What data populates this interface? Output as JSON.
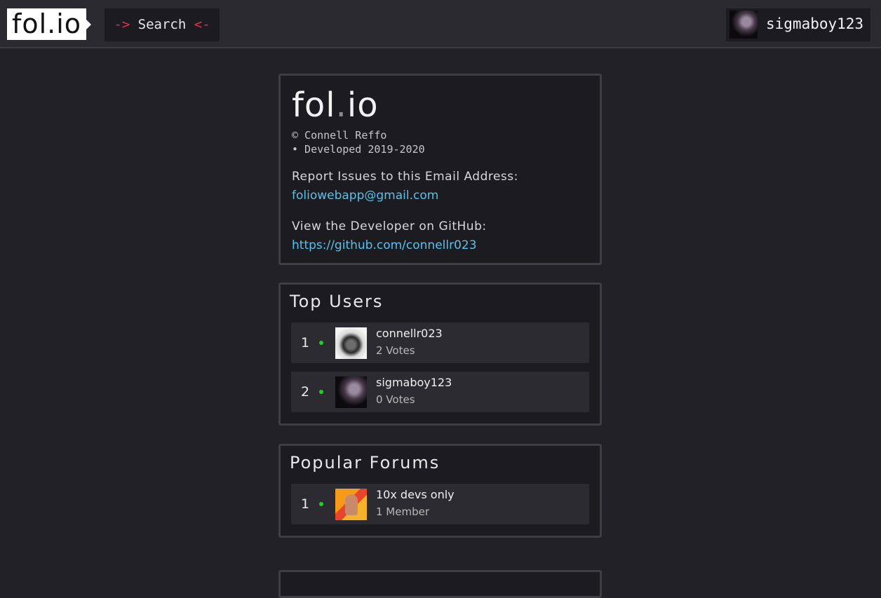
{
  "header": {
    "logo_text": "fol.io",
    "search_prefix": "->",
    "search_label": "Search",
    "search_suffix": "<-",
    "username": "sigmaboy123",
    "avatar_icon": "user-avatar-icon"
  },
  "info": {
    "logo_main": "fol",
    "logo_dot": ".",
    "logo_end": "io",
    "copyright": "© Connell Reffo",
    "developed": "• Developed 2019-2020",
    "issues_label": "Report Issues to this Email Address:",
    "issues_email": "foliowebapp@gmail.com",
    "github_label": "View the Developer on GitHub:",
    "github_url": "https://github.com/connellr023"
  },
  "top_users": {
    "title": "Top Users",
    "items": [
      {
        "rank": "1",
        "name": "connellr023",
        "sub": "2 Votes",
        "icon": "duckling-avatar-icon"
      },
      {
        "rank": "2",
        "name": "sigmaboy123",
        "sub": "0 Votes",
        "icon": "user-avatar-icon"
      }
    ]
  },
  "popular_forums": {
    "title": "Popular Forums",
    "items": [
      {
        "rank": "1",
        "name": "10x devs only",
        "sub": "1 Member",
        "icon": "forum-thumbnail-icon"
      }
    ]
  },
  "colors": {
    "accent_link": "#5bc0ea",
    "arrow_red": "#e8304a",
    "online_green": "#1fd22a"
  }
}
